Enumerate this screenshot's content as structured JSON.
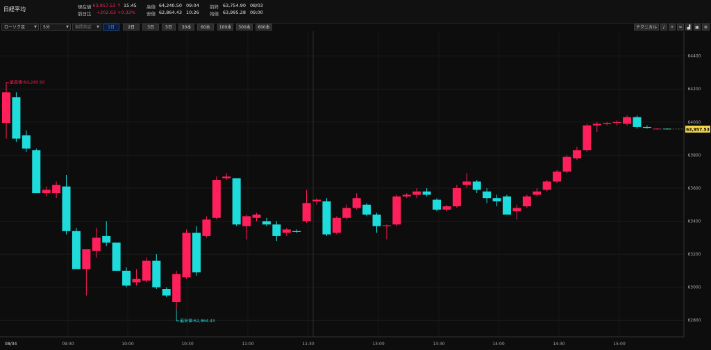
{
  "header": {
    "title": "日経平均",
    "current_label": "現在値",
    "current_value": "63,957.53 ↑",
    "current_time": "15:45",
    "change_label": "前日比",
    "change_value": "+202.63 +0.32%",
    "high_label": "高値",
    "high_value": "64,240.50",
    "high_time": "09:04",
    "low_label": "安値",
    "low_value": "62,864.43",
    "low_time": "10:26",
    "prev_label": "前終",
    "prev_value": "63,754.90",
    "prev_date": "08/03",
    "open_label": "始値",
    "open_value": "63,995.28",
    "open_time": "09:00"
  },
  "toolbar": {
    "chart_type": "ローソク足",
    "interval": "5分",
    "period_placeholder": "期間指定",
    "ranges": [
      "1日",
      "2日",
      "3日",
      "5日",
      "30本",
      "60本",
      "100本",
      "300本",
      "600本"
    ],
    "active_range": "1日",
    "technical_label": "テクニカル"
  },
  "annotations": {
    "high_label": "最高値:64,240.50",
    "low_label": "最安値:62,864.43"
  },
  "chart_data": {
    "type": "candlestick",
    "ylim": [
      62700,
      64550
    ],
    "y_ticks": [
      62800,
      63000,
      63200,
      63400,
      63600,
      63800,
      64000,
      64200,
      64400
    ],
    "x_ticks": [
      "08/04",
      "09:30",
      "10:00",
      "10:30",
      "11:00",
      "11:30",
      "13:00",
      "13:30",
      "14:00",
      "14:30",
      "15:00"
    ],
    "last_price": "63,957.53",
    "up_color": "#ff1f5a",
    "down_color": "#1fdcdc",
    "candles": [
      {
        "o": 63995,
        "h": 64240,
        "l": 63900,
        "c": 64180
      },
      {
        "o": 64150,
        "h": 64180,
        "l": 63880,
        "c": 63900
      },
      {
        "o": 63920,
        "h": 63950,
        "l": 63820,
        "c": 63840
      },
      {
        "o": 63830,
        "h": 63840,
        "l": 63570,
        "c": 63570
      },
      {
        "o": 63570,
        "h": 63610,
        "l": 63550,
        "c": 63590
      },
      {
        "o": 63570,
        "h": 63640,
        "l": 63540,
        "c": 63620
      },
      {
        "o": 63610,
        "h": 63680,
        "l": 63320,
        "c": 63340
      },
      {
        "o": 63340,
        "h": 63360,
        "l": 63110,
        "c": 63110
      },
      {
        "o": 63110,
        "h": 63230,
        "l": 62950,
        "c": 63230
      },
      {
        "o": 63220,
        "h": 63360,
        "l": 63180,
        "c": 63300
      },
      {
        "o": 63310,
        "h": 63400,
        "l": 63250,
        "c": 63270
      },
      {
        "o": 63270,
        "h": 63270,
        "l": 63100,
        "c": 63100
      },
      {
        "o": 63100,
        "h": 63120,
        "l": 63000,
        "c": 63010
      },
      {
        "o": 63030,
        "h": 63110,
        "l": 63010,
        "c": 63050
      },
      {
        "o": 63040,
        "h": 63180,
        "l": 63030,
        "c": 63160
      },
      {
        "o": 63160,
        "h": 63200,
        "l": 62990,
        "c": 63000
      },
      {
        "o": 62990,
        "h": 63000,
        "l": 62940,
        "c": 62950
      },
      {
        "o": 62910,
        "h": 63100,
        "l": 62864,
        "c": 63080
      },
      {
        "o": 63060,
        "h": 63350,
        "l": 63050,
        "c": 63330
      },
      {
        "o": 63330,
        "h": 63370,
        "l": 63070,
        "c": 63090
      },
      {
        "o": 63310,
        "h": 63430,
        "l": 63300,
        "c": 63410
      },
      {
        "o": 63420,
        "h": 63670,
        "l": 63410,
        "c": 63650
      },
      {
        "o": 63660,
        "h": 63690,
        "l": 63650,
        "c": 63670
      },
      {
        "o": 63660,
        "h": 63660,
        "l": 63370,
        "c": 63380
      },
      {
        "o": 63370,
        "h": 63440,
        "l": 63290,
        "c": 63430
      },
      {
        "o": 63420,
        "h": 63450,
        "l": 63400,
        "c": 63440
      },
      {
        "o": 63400,
        "h": 63420,
        "l": 63370,
        "c": 63380
      },
      {
        "o": 63380,
        "h": 63400,
        "l": 63280,
        "c": 63310
      },
      {
        "o": 63330,
        "h": 63360,
        "l": 63310,
        "c": 63350
      },
      {
        "o": 63340,
        "h": 63350,
        "l": 63330,
        "c": 63335
      },
      {
        "o": 63400,
        "h": 63590,
        "l": 63390,
        "c": 63510
      },
      {
        "o": 63520,
        "h": 63540,
        "l": 63500,
        "c": 63530
      },
      {
        "o": 63520,
        "h": 63540,
        "l": 63310,
        "c": 63320
      },
      {
        "o": 63330,
        "h": 63430,
        "l": 63320,
        "c": 63420
      },
      {
        "o": 63420,
        "h": 63500,
        "l": 63410,
        "c": 63480
      },
      {
        "o": 63480,
        "h": 63570,
        "l": 63470,
        "c": 63540
      },
      {
        "o": 63500,
        "h": 63510,
        "l": 63430,
        "c": 63440
      },
      {
        "o": 63440,
        "h": 63450,
        "l": 63330,
        "c": 63370
      },
      {
        "o": 63370,
        "h": 63380,
        "l": 63290,
        "c": 63375
      },
      {
        "o": 63380,
        "h": 63560,
        "l": 63370,
        "c": 63550
      },
      {
        "o": 63550,
        "h": 63570,
        "l": 63540,
        "c": 63560
      },
      {
        "o": 63560,
        "h": 63600,
        "l": 63540,
        "c": 63580
      },
      {
        "o": 63580,
        "h": 63600,
        "l": 63550,
        "c": 63560
      },
      {
        "o": 63530,
        "h": 63540,
        "l": 63460,
        "c": 63470
      },
      {
        "o": 63470,
        "h": 63500,
        "l": 63460,
        "c": 63490
      },
      {
        "o": 63490,
        "h": 63620,
        "l": 63480,
        "c": 63600
      },
      {
        "o": 63620,
        "h": 63690,
        "l": 63600,
        "c": 63640
      },
      {
        "o": 63640,
        "h": 63650,
        "l": 63570,
        "c": 63590
      },
      {
        "o": 63580,
        "h": 63600,
        "l": 63510,
        "c": 63540
      },
      {
        "o": 63540,
        "h": 63560,
        "l": 63490,
        "c": 63520
      },
      {
        "o": 63550,
        "h": 63560,
        "l": 63440,
        "c": 63440
      },
      {
        "o": 63460,
        "h": 63500,
        "l": 63410,
        "c": 63480
      },
      {
        "o": 63490,
        "h": 63560,
        "l": 63480,
        "c": 63550
      },
      {
        "o": 63560,
        "h": 63600,
        "l": 63550,
        "c": 63580
      },
      {
        "o": 63590,
        "h": 63650,
        "l": 63580,
        "c": 63640
      },
      {
        "o": 63640,
        "h": 63710,
        "l": 63630,
        "c": 63700
      },
      {
        "o": 63700,
        "h": 63800,
        "l": 63690,
        "c": 63790
      },
      {
        "o": 63780,
        "h": 63850,
        "l": 63770,
        "c": 63830
      },
      {
        "o": 63830,
        "h": 63990,
        "l": 63820,
        "c": 63980
      },
      {
        "o": 63980,
        "h": 64000,
        "l": 63940,
        "c": 63990
      },
      {
        "o": 63990,
        "h": 64000,
        "l": 63980,
        "c": 63995
      },
      {
        "o": 63995,
        "h": 64010,
        "l": 63980,
        "c": 64000
      },
      {
        "o": 63990,
        "h": 64040,
        "l": 63980,
        "c": 64030
      },
      {
        "o": 64030,
        "h": 64040,
        "l": 63960,
        "c": 63970
      },
      {
        "o": 63970,
        "h": 63980,
        "l": 63960,
        "c": 63965
      },
      {
        "o": 63958,
        "h": 63965,
        "l": 63955,
        "c": 63960
      },
      {
        "o": 63960,
        "h": 63962,
        "l": 63955,
        "c": 63957
      }
    ]
  }
}
